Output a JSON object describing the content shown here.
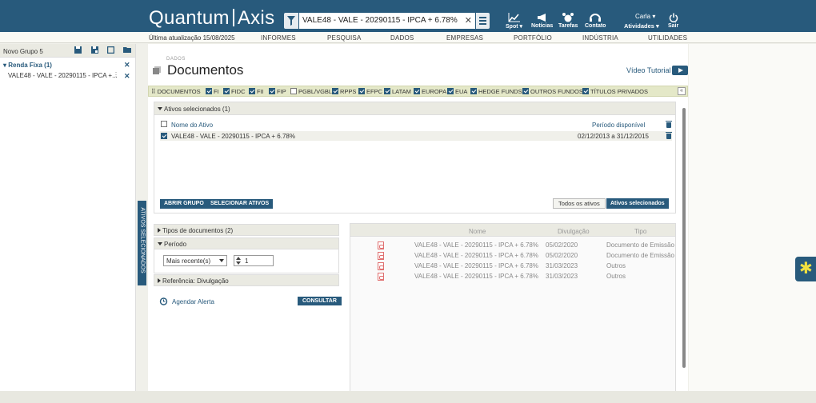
{
  "header": {
    "logo_left": "Quantum",
    "logo_right": "Axis",
    "search_value": "VALE48 - VALE - 20290115 - IPCA + 6.78%",
    "icons": [
      {
        "label": "Spot",
        "icon": "chart-icon"
      },
      {
        "label": "Notícias",
        "icon": "megaphone-icon"
      },
      {
        "label": "Tarefas",
        "icon": "alarm-clock-icon"
      },
      {
        "label": "Contato",
        "icon": "headset-icon"
      }
    ],
    "user": "Carla",
    "activities": "Atividades",
    "logout": "Sair"
  },
  "nav": {
    "updated": "Última atualização 15/08/2025",
    "items": [
      "INFORMES",
      "PESQUISA",
      "DADOS",
      "EMPRESAS",
      "PORTFÓLIO",
      "INDÚSTRIA",
      "UTILIDADES"
    ]
  },
  "left": {
    "group": "Novo Grupo 5",
    "section": "Renda Fixa (1)",
    "asset": "VALE48 - VALE - 20290115 - IPCA +..."
  },
  "vertical_tab": "ATIVOS SELECIONADOS",
  "page": {
    "crumb": "DADOS",
    "title": "Documentos",
    "video": "Vídeo Tutorial"
  },
  "doctypes": {
    "label": "DOCUMENTOS",
    "items": [
      {
        "label": "FI",
        "checked": true
      },
      {
        "label": "FIDC",
        "checked": true
      },
      {
        "label": "FII",
        "checked": true
      },
      {
        "label": "FIP",
        "checked": true
      },
      {
        "label": "PGBL/VGBL",
        "checked": false
      },
      {
        "label": "RPPS",
        "checked": true
      },
      {
        "label": "EFPC",
        "checked": true
      },
      {
        "label": "LATAM",
        "checked": true
      },
      {
        "label": "EUROPA",
        "checked": true
      },
      {
        "label": "EUA",
        "checked": true
      },
      {
        "label": "HEDGE FUNDS",
        "checked": true
      },
      {
        "label": "OUTROS FUNDOS",
        "checked": true
      },
      {
        "label": "TÍTULOS PRIVADOS",
        "checked": true
      }
    ],
    "collapse": "«"
  },
  "selected": {
    "title": "Ativos selecionados (1)",
    "col_name": "Nome do Ativo",
    "col_period": "Período disponível",
    "row_name": "VALE48 - VALE - 20290115 - IPCA + 6.78%",
    "row_period": "02/12/2013 a 31/12/2015",
    "btn_open": "ABRIR GRUPO",
    "btn_select": "SELECIONAR ATIVOS",
    "btn_all": "Todos os ativos",
    "btn_sel": "Ativos selecionados"
  },
  "filters": {
    "types": "Tipos de documentos (2)",
    "period": "Período",
    "period_select": "Mais recente(s)",
    "period_count": "1",
    "reference": "Referência: Divulgação",
    "alert": "Agendar Alerta",
    "consult": "CONSULTAR"
  },
  "results": {
    "headers": {
      "name": "Nome",
      "date": "Divulgação",
      "type": "Tipo"
    },
    "rows": [
      {
        "name": "VALE48 - VALE - 20290115 - IPCA + 6.78%",
        "date": "05/02/2020",
        "type": "Documento de Emissão"
      },
      {
        "name": "VALE48 - VALE - 20290115 - IPCA + 6.78%",
        "date": "05/02/2020",
        "type": "Documento de Emissão"
      },
      {
        "name": "VALE48 - VALE - 20290115 - IPCA + 6.78%",
        "date": "31/03/2023",
        "type": "Outros"
      },
      {
        "name": "VALE48 - VALE - 20290115 - IPCA + 6.78%",
        "date": "31/03/2023",
        "type": "Outros"
      }
    ]
  }
}
